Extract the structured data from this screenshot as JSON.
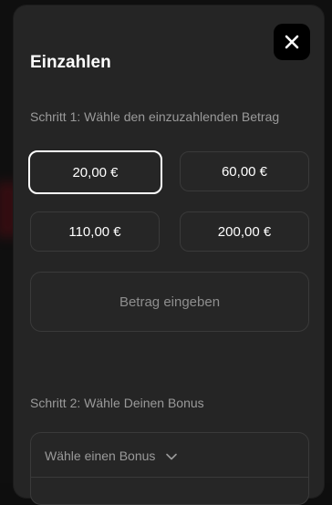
{
  "modal": {
    "title": "Einzahlen",
    "close_icon": "close-icon"
  },
  "step1": {
    "label": "Schritt 1: Wähle den einzuzahlenden Betrag",
    "amounts": [
      "20,00 €",
      "60,00 €",
      "110,00 €",
      "200,00 €"
    ],
    "selected_index": 0,
    "custom_placeholder": "Betrag eingeben"
  },
  "step2": {
    "label": "Schritt 2: Wähle Deinen Bonus",
    "select_value": "Wähle einen Bonus",
    "select_icon": "chevron-down-icon"
  },
  "colors": {
    "modal_bg": "#252525",
    "selected_border": "#ffffff",
    "text_primary": "#ffffff",
    "text_muted": "#9a9a9a"
  }
}
